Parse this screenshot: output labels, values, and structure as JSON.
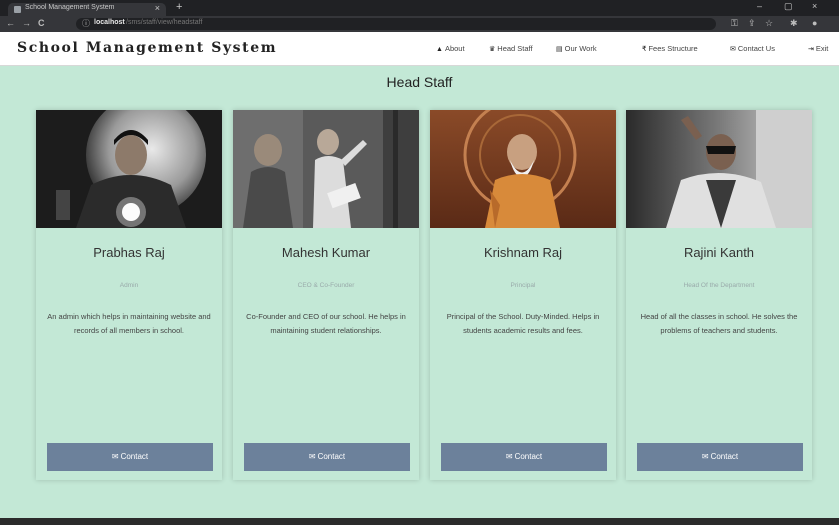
{
  "browser": {
    "tab_title": "School Management System",
    "tab_close": "×",
    "new_tab": "+",
    "url_host": "localhost",
    "url_path": "/sms/staff/view/headstaff",
    "info_icon": "ⓘ",
    "back": "←",
    "forward": "→",
    "reload": "C",
    "minimize": "‒",
    "maximize": "▢",
    "close": "×"
  },
  "site": {
    "brand": "School Management System",
    "nav": [
      {
        "icon": "▲",
        "label": "About"
      },
      {
        "icon": "♛",
        "label": "Head Staff"
      },
      {
        "icon": "▤",
        "label": "Our Work"
      },
      {
        "icon": "₹",
        "label": "Fees Structure"
      },
      {
        "icon": "✉",
        "label": "Contact Us"
      },
      {
        "icon": "⇥",
        "label": "Exit"
      }
    ]
  },
  "section": {
    "heading": "Head Staff"
  },
  "staff": [
    {
      "name": "Prabhas Raj",
      "role": "Admin",
      "description": "An admin which helps in maintaining website and records of all members in school.",
      "button": "Contact",
      "button_icon": "✉"
    },
    {
      "name": "Mahesh Kumar",
      "role": "CEO & Co-Founder",
      "description": "Co-Founder and CEO of our school. He helps in maintaining student relationships.",
      "button": "Contact",
      "button_icon": "✉"
    },
    {
      "name": "Krishnam Raj",
      "role": "Principal",
      "description": "Principal of the School. Duty-Minded. Helps in students academic results and fees.",
      "button": "Contact",
      "button_icon": "✉"
    },
    {
      "name": "Rajini Kanth",
      "role": "Head Of the Department",
      "description": "Head of all the classes in school. He solves the problems of teachers and students.",
      "button": "Contact",
      "button_icon": "✉"
    }
  ],
  "colors": {
    "page_bg": "#c3e8d6",
    "button": "#6c819b",
    "navbar": "#ffffff"
  }
}
